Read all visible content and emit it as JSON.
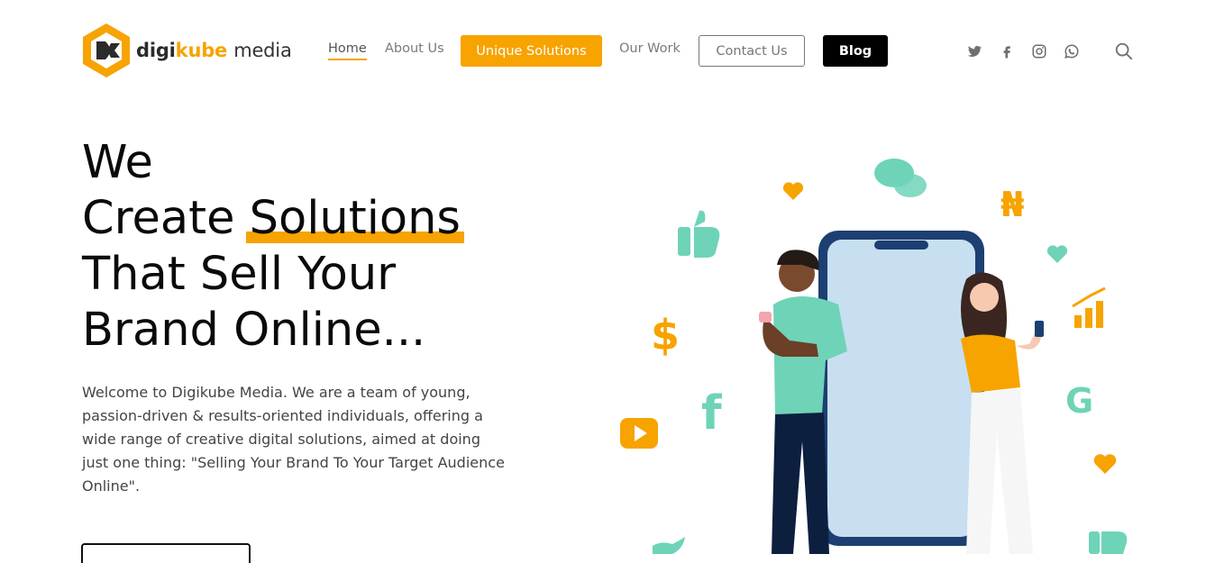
{
  "brand": {
    "name_part1": "digi",
    "name_part2": "kube",
    "name_part3": "media",
    "accent": "#f7a300"
  },
  "nav": {
    "home": "Home",
    "about": "About Us",
    "unique": "Unique Solutions",
    "work": "Our Work",
    "contact": "Contact Us",
    "blog": "Blog"
  },
  "social_icons": [
    "twitter-icon",
    "facebook-icon",
    "instagram-icon",
    "whatsapp-icon"
  ],
  "hero": {
    "line1": "We",
    "line2_pre": "Create ",
    "line2_highlight": "Solutions",
    "line3": "That Sell Your",
    "line4": "Brand Online...",
    "intro": "Welcome to Digikube Media. We are a team of young, passion-driven & results-oriented individuals, offering a wide range of creative digital solutions, aimed at doing just one thing: \"Selling Your Brand To Your Target Audience Online\"."
  },
  "colors": {
    "orange": "#f7a300",
    "teal": "#6fd3b8",
    "dark": "#0b2a55"
  }
}
